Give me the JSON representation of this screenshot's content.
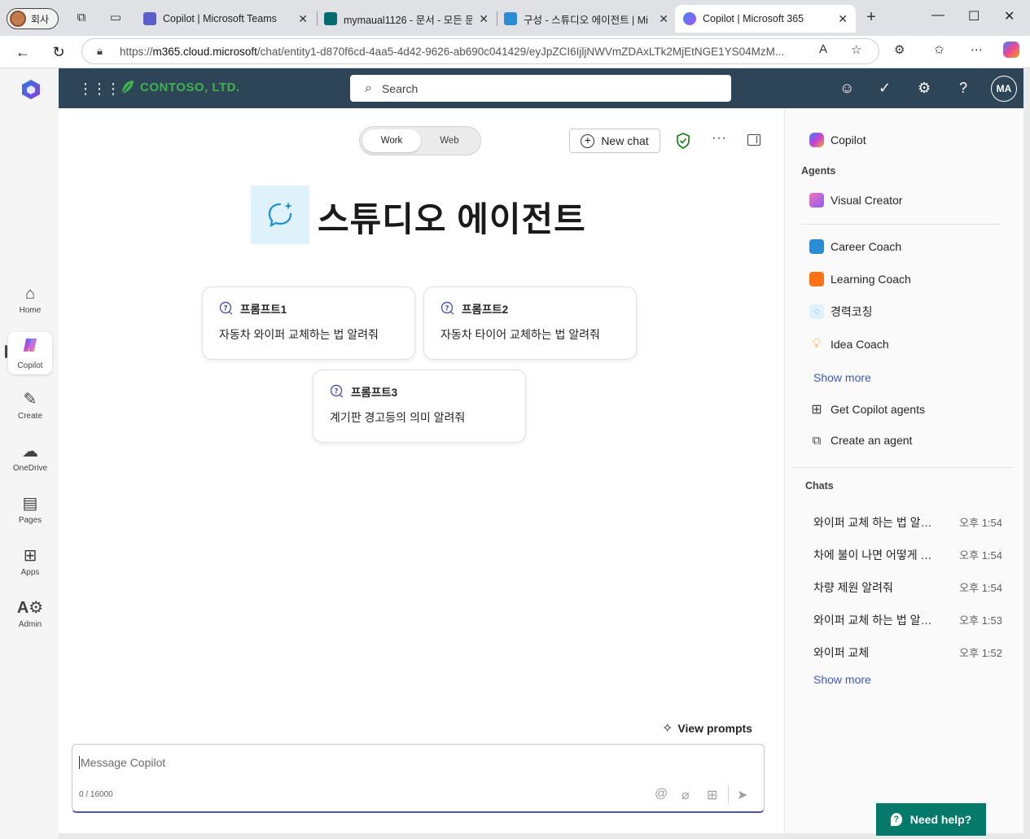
{
  "browser": {
    "profile_label": "회사",
    "tabs": [
      {
        "title": "Copilot | Microsoft Teams",
        "color": "#5b5fc7"
      },
      {
        "title": "mymaual1126 - 문서 - 모든 문",
        "color": "#036c70"
      },
      {
        "title": "구성 - 스튜디오 에이전트 | Mi",
        "color": "#2b8cd6"
      },
      {
        "title": "Copilot | Microsoft 365",
        "color": "#5b5fc7"
      }
    ],
    "url_prefix": "https://",
    "url_host": "m365.cloud.microsoft",
    "url_path": "/chat/entity1-d870f6cd-4aa5-4d42-9626-ab690c041429/eyJpZCI6IjljNWVmZDAxLTk2MjEtNGE1YS04MzM..."
  },
  "rail": {
    "items": [
      {
        "label": "Home",
        "icon": "home-icon"
      },
      {
        "label": "Copilot",
        "icon": "copilot-icon"
      },
      {
        "label": "Create",
        "icon": "pen-icon"
      },
      {
        "label": "OneDrive",
        "icon": "cloud-icon"
      },
      {
        "label": "Pages",
        "icon": "pages-icon"
      },
      {
        "label": "Apps",
        "icon": "apps-icon"
      },
      {
        "label": "Admin",
        "icon": "admin-icon"
      }
    ]
  },
  "topbar": {
    "brand": "CONTOSO, LTD.",
    "search_placeholder": "Search",
    "avatar_initials": "MA"
  },
  "main": {
    "toggle_work": "Work",
    "toggle_web": "Web",
    "new_chat": "New chat",
    "agent_title": "스튜디오 에이전트",
    "prompts": [
      {
        "title": "프롬프트1",
        "text": "자동차 와이퍼 교체하는 법 알려줘"
      },
      {
        "title": "프롬프트2",
        "text": "자동차 타이어 교체하는 법 알려줘"
      },
      {
        "title": "프롬프트3",
        "text": "계기판 경고등의 의미 알려줘"
      }
    ],
    "view_prompts": "View prompts",
    "composer_placeholder": "Message Copilot",
    "char_count": "0 / 16000"
  },
  "sidebar": {
    "copilot": "Copilot",
    "agents_heading": "Agents",
    "agents": [
      {
        "name": "Visual Creator",
        "icon": "visual-creator-icon"
      },
      {
        "name": "Career Coach",
        "icon": "career-coach-icon"
      },
      {
        "name": "Learning Coach",
        "icon": "learning-coach-icon"
      },
      {
        "name": "경력코칭",
        "icon": "studio-agent-icon"
      },
      {
        "name": "Idea Coach",
        "icon": "idea-coach-icon"
      }
    ],
    "agents_show_more": "Show more",
    "get_agents": "Get Copilot agents",
    "create_agent": "Create an agent",
    "chats_heading": "Chats",
    "chats": [
      {
        "title": "와이퍼 교체 하는 법 알려줘",
        "time": "오후 1:54"
      },
      {
        "title": "차에 불이 나면 어떻게 해야 해",
        "time": "오후 1:54"
      },
      {
        "title": "차량 제원 알려줘",
        "time": "오후 1:54"
      },
      {
        "title": "와이퍼 교체 하는 법 알려줘",
        "time": "오후 1:53"
      },
      {
        "title": "와이퍼 교체",
        "time": "오후 1:52"
      }
    ],
    "chats_show_more": "Show more"
  },
  "help": {
    "label": "Need help?"
  }
}
